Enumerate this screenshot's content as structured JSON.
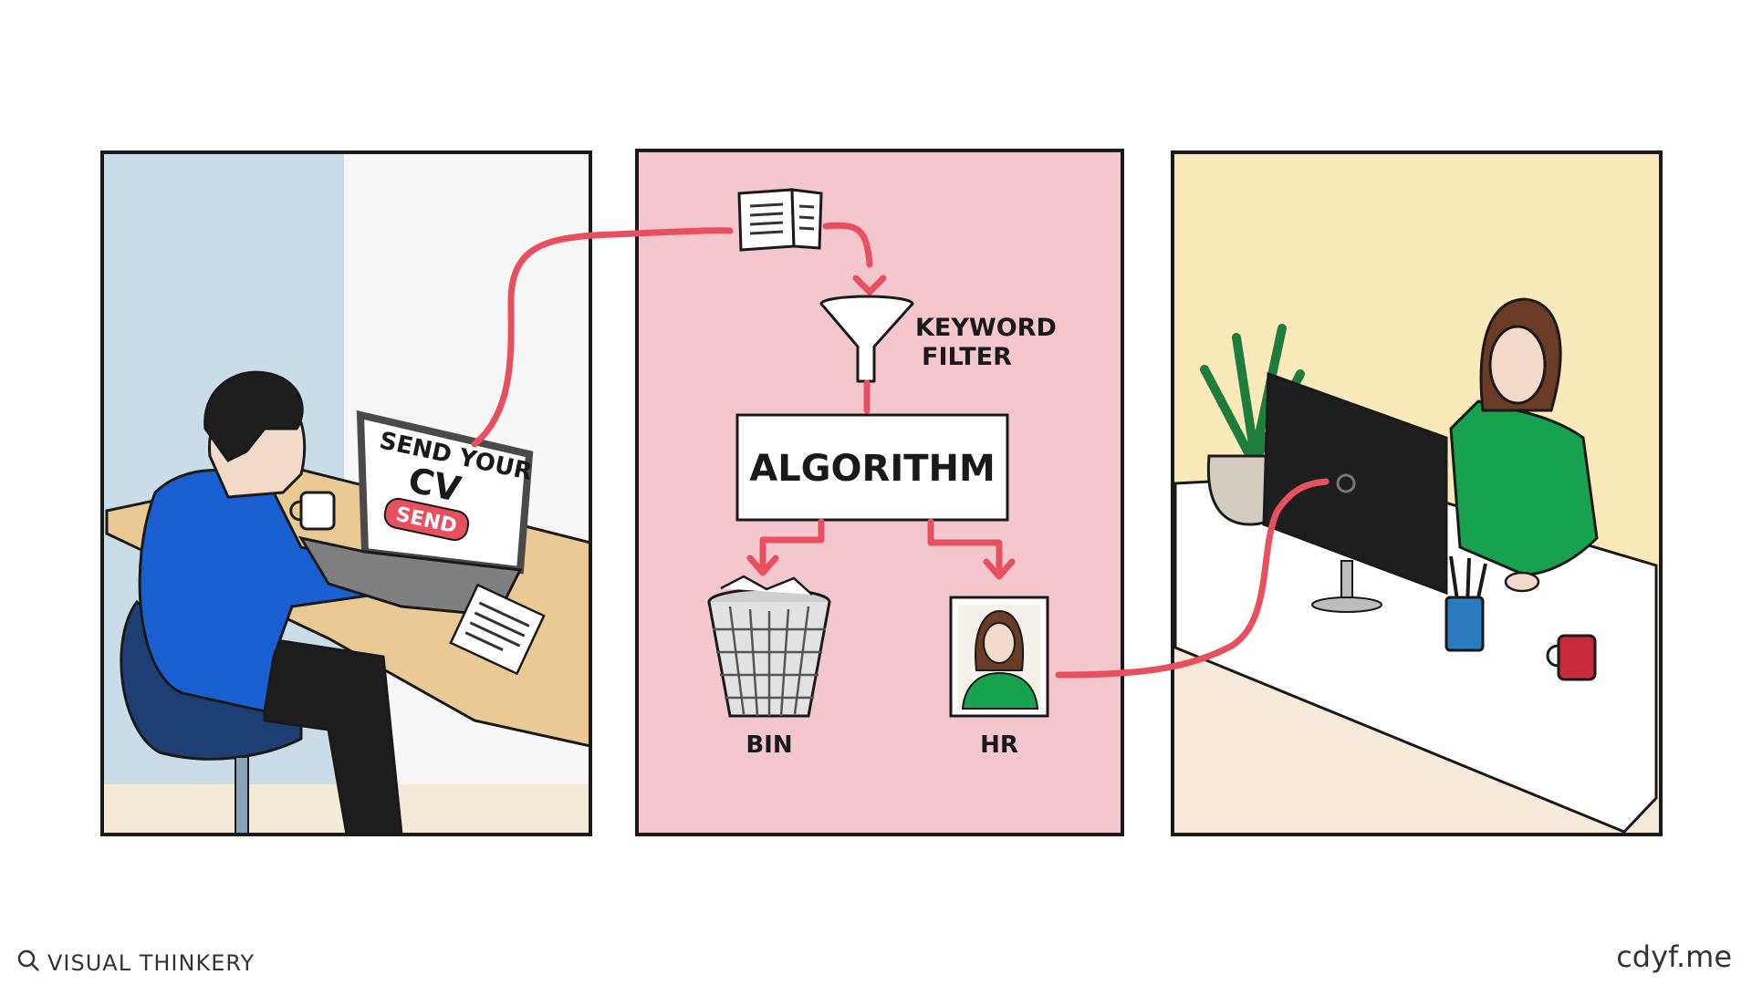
{
  "colors": {
    "panel1_wall": "#c9dde8",
    "panel1_white": "#f6f6f6",
    "panel2_bg": "#f4c7cf",
    "panel3_bg": "#fbeab9",
    "connector": "#e8505f",
    "hoodie": "#1a5fd1",
    "sweater": "#17a24f"
  },
  "icons": [
    "document-icon",
    "funnel-icon",
    "bin-icon",
    "portrait-icon",
    "cup-icon",
    "plant-icon",
    "monitor-icon",
    "pen-holder-icon",
    "search-logo-icon"
  ],
  "laptop_screen": {
    "line1": "SEND YOUR",
    "line2": "CV",
    "button": "SEND"
  },
  "flow": {
    "filter_line1": "KEYWORD",
    "filter_line2": "FILTER",
    "algorithm": "ALGORITHM",
    "bin": "BIN",
    "hr": "HR"
  },
  "footer": {
    "left": "VISUAL THINKERY",
    "right": "cdyf.me"
  }
}
